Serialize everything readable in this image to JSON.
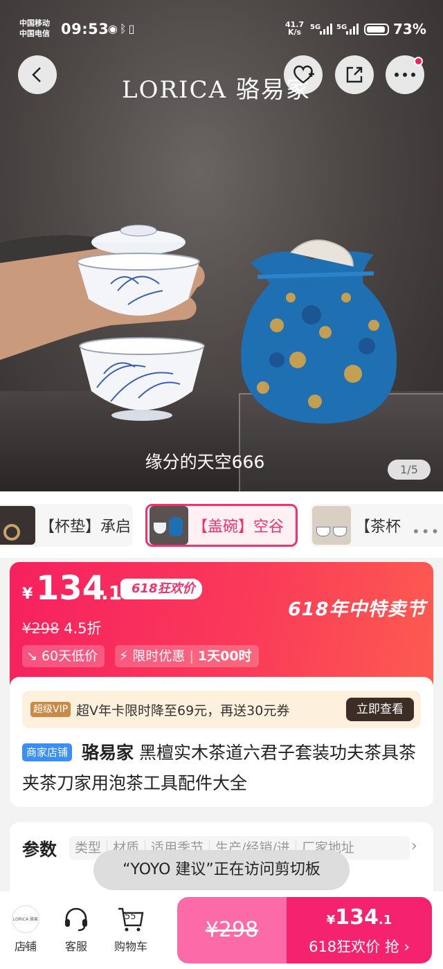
{
  "status_bar": {
    "carrier_1": "中国移动",
    "carrier_2": "中国电信",
    "time": "09:53",
    "net_speed_value": "41.7",
    "net_speed_unit": "K/s",
    "sim1": "5G",
    "sim2": "5G",
    "battery": "73%"
  },
  "header": {
    "brand": "LORICA 骆易家",
    "back_icon": "chevron-left-icon",
    "favorite_icon": "heart-plus-icon",
    "share_icon": "share-icon",
    "more_icon": "ellipsis-icon",
    "notification_color": "#f1225a"
  },
  "gallery": {
    "caption": "缘分的天空666",
    "counter": "1/5"
  },
  "variants": [
    {
      "label": "【杯垫】承启"
    },
    {
      "label": "【盖碗】空谷",
      "selected": true
    },
    {
      "label": "【茶杯"
    }
  ],
  "price": {
    "currency": "¥",
    "integer": "134",
    "decimal": ".1",
    "event_tag": "618狂欢价",
    "festival": "618年中特卖节",
    "original": "¥298",
    "discount": "4.5折",
    "low_badge": "60天低价",
    "limited_label": "限时优惠",
    "countdown": "1天00时",
    "accent_color": "#f6215f"
  },
  "vip": {
    "tag": "超级VIP",
    "text": "超V年卡限时降至69元，再送30元券",
    "button": "立即查看"
  },
  "product": {
    "shop_tag": "商家店铺",
    "brand": "骆易家",
    "title": "黑檀实木茶道六君子套装功夫茶具茶夹茶刀家用泡茶工具配件大全"
  },
  "params": {
    "label": "参数",
    "chips": [
      "类型",
      "材质",
      "适用季节",
      "生产/经销/进",
      "厂家地址"
    ]
  },
  "toast": "“YOYO 建议”正在访问剪切板",
  "bottom_bar": {
    "shop_logo": "LORICA 骆易家",
    "shop": "店铺",
    "service": "客服",
    "cart": "购物车",
    "cart_count": "55",
    "buy_original": "¥298",
    "buy_price_currency": "¥",
    "buy_price_integer": "134",
    "buy_price_decimal": ".1",
    "buy_label": "618狂欢价 抢"
  }
}
